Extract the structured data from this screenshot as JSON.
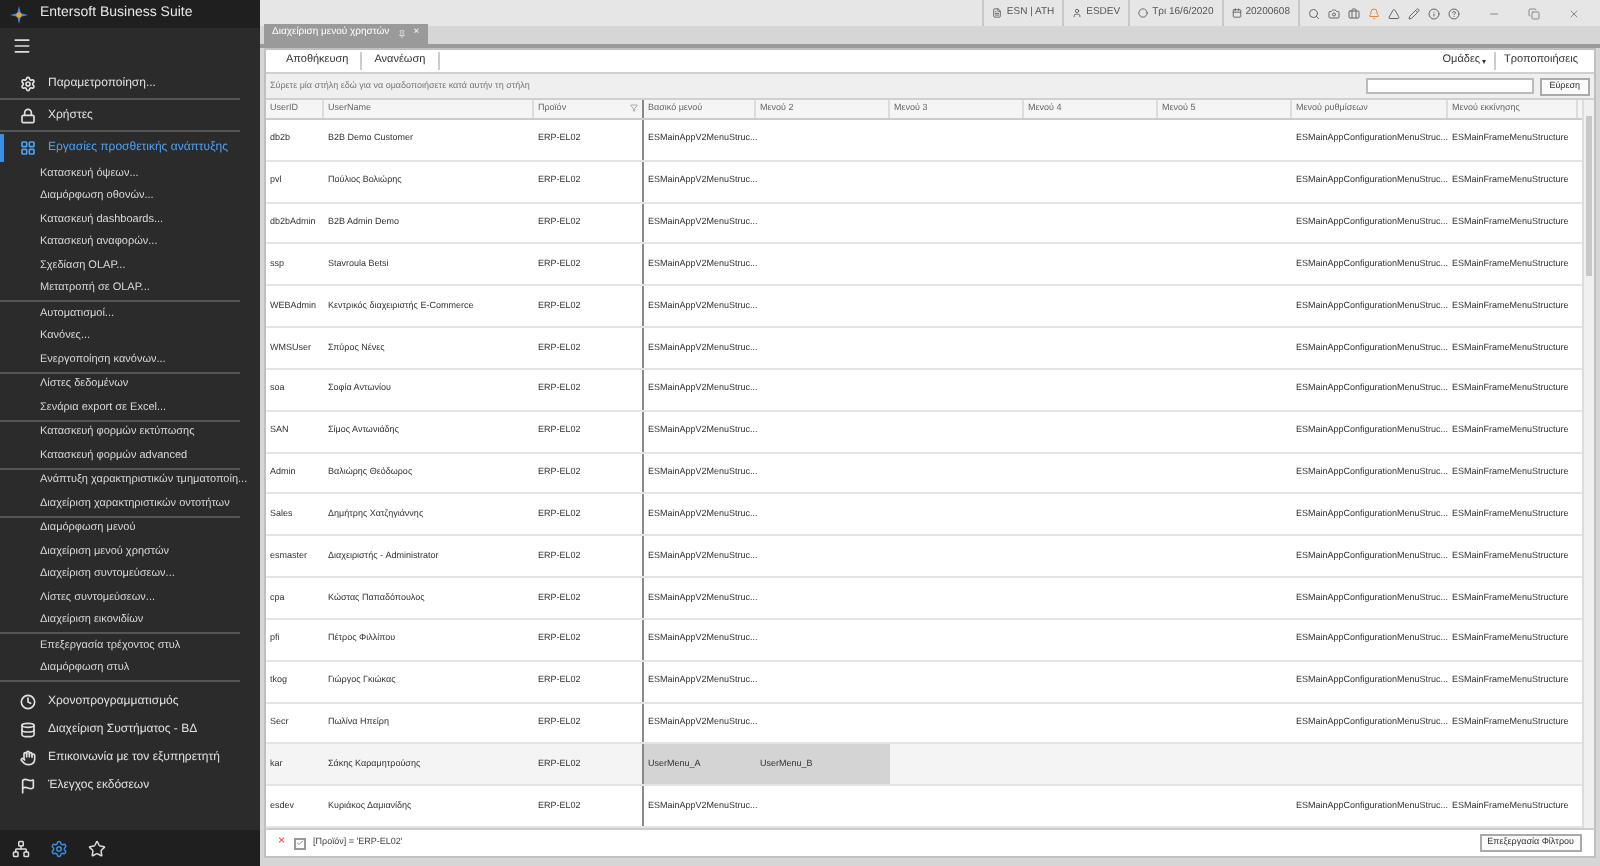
{
  "app_title": "Entersoft Business Suite",
  "sidebar": {
    "top_items": [
      {
        "label": "Παραμετροποίηση...",
        "selected": false
      },
      {
        "label": "Χρήστες",
        "selected": false
      },
      {
        "label": "Εργασίες προσθετικής ανάπτυξης",
        "selected": true
      }
    ],
    "sub_groups": [
      [
        "Κατασκευή όψεων...",
        "Διαμόρφωση οθονών...",
        "Κατασκευή dashboards...",
        "Κατασκευή αναφορών...",
        "Σχεδίαση OLAP...",
        "Μετατροπή σε OLAP..."
      ],
      [
        "Αυτοματισμοί...",
        "Κανόνες...",
        "Ενεργοποίηση κανόνων..."
      ],
      [
        "Λίστες δεδομένων",
        "Σενάρια export σε Excel..."
      ],
      [
        "Κατασκευή φορμών εκτύπωσης",
        "Κατασκευή φορμών advanced"
      ],
      [
        "Ανάπτυξη χαρακτηριστικών τμηματοποίη...",
        "Διαχείριση χαρακτηριστικών οντοτήτων"
      ],
      [
        "Διαμόρφωση μενού",
        "Διαχείριση μενού χρηστών",
        "Διαχείριση συντομεύσεων...",
        "Λίστες συντομεύσεων...",
        "Διαχείριση εικονιδίων"
      ],
      [
        "Επεξεργασία τρέχοντος στυλ",
        "Διαμόρφωση στυλ"
      ]
    ],
    "bottom_items": [
      {
        "label": "Χρονοπρογραμματισμός",
        "selected": false
      },
      {
        "label": "Διαχείριση Συστήματος - ΒΔ",
        "selected": false
      },
      {
        "label": "Επικοινωνία με τον εξυπηρετητή",
        "selected": false
      },
      {
        "label": "Έλεγχος εκδόσεων",
        "selected": false
      }
    ]
  },
  "status_bar": [
    "ESN | ATH",
    "ESDEV",
    "Τρι 16/6/2020",
    "20200608"
  ],
  "tab": {
    "title": "Διαχείριση μενού χρηστών",
    "close": "×"
  },
  "toolbar": {
    "left": [
      "Αποθήκευση",
      "Ανανέωση"
    ],
    "groups": "Ομάδες",
    "groups_caret": "▾",
    "changes": "Τροποποιήσεις"
  },
  "group_panel": "Σύρετε μία στήλη εδώ για να ομαδοποιήσετε κατά αυτήν τη στήλη",
  "search": {
    "button": "Εύρεση"
  },
  "table": {
    "columns": [
      "UserID",
      "UserName",
      "Προϊόν",
      "Βασικό μενού",
      "Μενού 2",
      "Μενού 3",
      "Μενού 4",
      "Μενού 5",
      "Μενού ρυθμίσεων",
      "Μενού εκκίνησης"
    ],
    "rows": [
      {
        "selected": false,
        "cells": [
          "db2b",
          "B2B Demo Customer",
          "ERP-EL02",
          "ESMainAppV2MenuStruc...",
          "",
          "",
          "",
          "",
          "ESMainAppConfigurationMenuStruc...",
          "ESMainFrameMenuStructure"
        ]
      },
      {
        "selected": false,
        "cells": [
          "pvl",
          "Πούλιος Βολιώρης",
          "ERP-EL02",
          "ESMainAppV2MenuStruc...",
          "",
          "",
          "",
          "",
          "ESMainAppConfigurationMenuStruc...",
          "ESMainFrameMenuStructure"
        ]
      },
      {
        "selected": false,
        "cells": [
          "db2bAdmin",
          "B2B Admin Demo",
          "ERP-EL02",
          "ESMainAppV2MenuStruc...",
          "",
          "",
          "",
          "",
          "ESMainAppConfigurationMenuStruc...",
          "ESMainFrameMenuStructure"
        ]
      },
      {
        "selected": false,
        "cells": [
          "ssp",
          "Stavroula Betsi",
          "ERP-EL02",
          "ESMainAppV2MenuStruc...",
          "",
          "",
          "",
          "",
          "ESMainAppConfigurationMenuStruc...",
          "ESMainFrameMenuStructure"
        ]
      },
      {
        "selected": false,
        "cells": [
          "WEBAdmin",
          "Κεντρικός διαχειριστής E-Commerce",
          "ERP-EL02",
          "ESMainAppV2MenuStruc...",
          "",
          "",
          "",
          "",
          "ESMainAppConfigurationMenuStruc...",
          "ESMainFrameMenuStructure"
        ]
      },
      {
        "selected": false,
        "cells": [
          "WMSUser",
          "Σπύρος Νένες",
          "ERP-EL02",
          "ESMainAppV2MenuStruc...",
          "",
          "",
          "",
          "",
          "ESMainAppConfigurationMenuStruc...",
          "ESMainFrameMenuStructure"
        ]
      },
      {
        "selected": false,
        "cells": [
          "soa",
          "Σοφία Αντωνίου",
          "ERP-EL02",
          "ESMainAppV2MenuStruc...",
          "",
          "",
          "",
          "",
          "ESMainAppConfigurationMenuStruc...",
          "ESMainFrameMenuStructure"
        ]
      },
      {
        "selected": false,
        "cells": [
          "SAN",
          "Σίμος Αντωνιάδης",
          "ERP-EL02",
          "ESMainAppV2MenuStruc...",
          "",
          "",
          "",
          "",
          "ESMainAppConfigurationMenuStruc...",
          "ESMainFrameMenuStructure"
        ]
      },
      {
        "selected": false,
        "cells": [
          "Admin",
          "Βαλιώρης Θεόδωρος",
          "ERP-EL02",
          "ESMainAppV2MenuStruc...",
          "",
          "",
          "",
          "",
          "ESMainAppConfigurationMenuStruc...",
          "ESMainFrameMenuStructure"
        ]
      },
      {
        "selected": false,
        "cells": [
          "Sales",
          "Δημήτρης Χατζηγιάννης",
          "ERP-EL02",
          "ESMainAppV2MenuStruc...",
          "",
          "",
          "",
          "",
          "ESMainAppConfigurationMenuStruc...",
          "ESMainFrameMenuStructure"
        ]
      },
      {
        "selected": false,
        "cells": [
          "esmaster",
          "Διαχειριστής - Administrator",
          "ERP-EL02",
          "ESMainAppV2MenuStruc...",
          "",
          "",
          "",
          "",
          "ESMainAppConfigurationMenuStruc...",
          "ESMainFrameMenuStructure"
        ]
      },
      {
        "selected": false,
        "cells": [
          "cpa",
          "Κώστας Παπαδόπουλος",
          "ERP-EL02",
          "ESMainAppV2MenuStruc...",
          "",
          "",
          "",
          "",
          "ESMainAppConfigurationMenuStruc...",
          "ESMainFrameMenuStructure"
        ]
      },
      {
        "selected": false,
        "cells": [
          "pfi",
          "Πέτρος Φιλλίπου",
          "ERP-EL02",
          "ESMainAppV2MenuStruc...",
          "",
          "",
          "",
          "",
          "ESMainAppConfigurationMenuStruc...",
          "ESMainFrameMenuStructure"
        ]
      },
      {
        "selected": false,
        "cells": [
          "tkog",
          "Γιώργος Γκιώκας",
          "ERP-EL02",
          "ESMainAppV2MenuStruc...",
          "",
          "",
          "",
          "",
          "ESMainAppConfigurationMenuStruc...",
          "ESMainFrameMenuStructure"
        ]
      },
      {
        "selected": false,
        "cells": [
          "Secr",
          "Πωλίνα Ηπείρη",
          "ERP-EL02",
          "ESMainAppV2MenuStruc...",
          "",
          "",
          "",
          "",
          "ESMainAppConfigurationMenuStruc...",
          "ESMainFrameMenuStructure"
        ]
      },
      {
        "selected": true,
        "cells": [
          "kar",
          "Σάκης Καραμητρούσης",
          "ERP-EL02",
          "UserMenu_A",
          "UserMenu_B",
          "",
          "",
          "",
          "",
          ""
        ]
      },
      {
        "selected": false,
        "cells": [
          "esdev",
          "Κυριάκος Δαμιανίδης",
          "ERP-EL02",
          "ESMainAppV2MenuStruc...",
          "",
          "",
          "",
          "",
          "ESMainAppConfigurationMenuStruc...",
          "ESMainFrameMenuStructure"
        ]
      }
    ]
  },
  "filter": {
    "remove": "×",
    "enabled": true,
    "expression": "[Προϊόν] = 'ERP-EL02'",
    "edit_button": "Επεξεργασία Φίλτρου"
  }
}
